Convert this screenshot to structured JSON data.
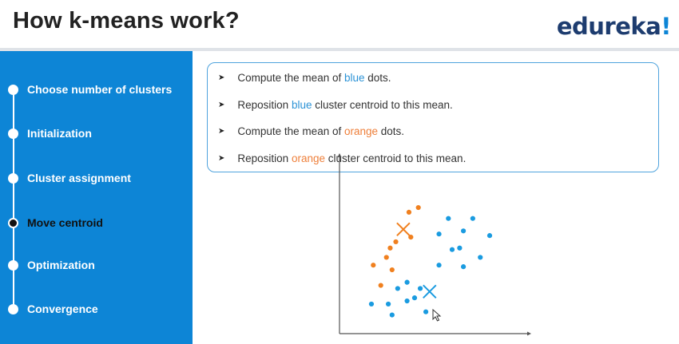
{
  "header": {
    "title": "How k-means work?",
    "logo_text": "edureka",
    "logo_bang": "!"
  },
  "sidebar": {
    "items": [
      {
        "label": "Choose number of clusters",
        "active": false
      },
      {
        "label": "Initialization",
        "active": false
      },
      {
        "label": "Cluster assignment",
        "active": false
      },
      {
        "label": "Move centroid",
        "active": true
      },
      {
        "label": "Optimization",
        "active": false
      },
      {
        "label": "Convergence",
        "active": false
      }
    ]
  },
  "steps": [
    {
      "before": "Compute the mean of ",
      "highlight": "blue",
      "after": " dots."
    },
    {
      "before": "Reposition ",
      "highlight": "blue",
      "after": " cluster centroid to this mean."
    },
    {
      "before": "Compute the mean of ",
      "highlight": "orange",
      "after": " dots."
    },
    {
      "before": "Reposition ",
      "highlight": "orange",
      "after": " cluster centroid to this mean."
    }
  ],
  "colors": {
    "sidebar": "#0d85d6",
    "blue_cluster": "#1a9be0",
    "orange_cluster": "#f0801f"
  },
  "chart_data": {
    "type": "scatter",
    "title": "",
    "xlabel": "",
    "ylabel": "",
    "xlim": [
      0,
      10
    ],
    "ylim": [
      0,
      10
    ],
    "grid": false,
    "series": [
      {
        "color": "#f0801f",
        "points": [
          [
            3.7,
            7.8
          ],
          [
            4.2,
            8.1
          ],
          [
            3.8,
            6.2
          ],
          [
            3.0,
            5.9
          ],
          [
            2.5,
            4.9
          ],
          [
            2.8,
            4.1
          ],
          [
            1.8,
            4.4
          ],
          [
            2.2,
            3.1
          ],
          [
            2.7,
            5.5
          ]
        ]
      },
      {
        "color": "#1a9be0",
        "points": [
          [
            5.8,
            7.4
          ],
          [
            7.1,
            7.4
          ],
          [
            6.6,
            6.6
          ],
          [
            5.3,
            6.4
          ],
          [
            8.0,
            6.3
          ],
          [
            6.4,
            5.5
          ],
          [
            6.0,
            5.4
          ],
          [
            5.3,
            4.4
          ],
          [
            6.6,
            4.3
          ],
          [
            7.5,
            4.9
          ],
          [
            3.6,
            3.3
          ],
          [
            3.1,
            2.9
          ],
          [
            4.0,
            2.3
          ],
          [
            4.3,
            2.9
          ],
          [
            3.6,
            2.1
          ],
          [
            2.6,
            1.9
          ],
          [
            1.7,
            1.9
          ],
          [
            2.8,
            1.2
          ],
          [
            4.6,
            1.4
          ]
        ]
      }
    ],
    "centroids": [
      {
        "color": "#f0801f",
        "x": 3.4,
        "y": 6.7
      },
      {
        "color": "#1a9be0",
        "x": 4.8,
        "y": 2.7
      }
    ]
  }
}
